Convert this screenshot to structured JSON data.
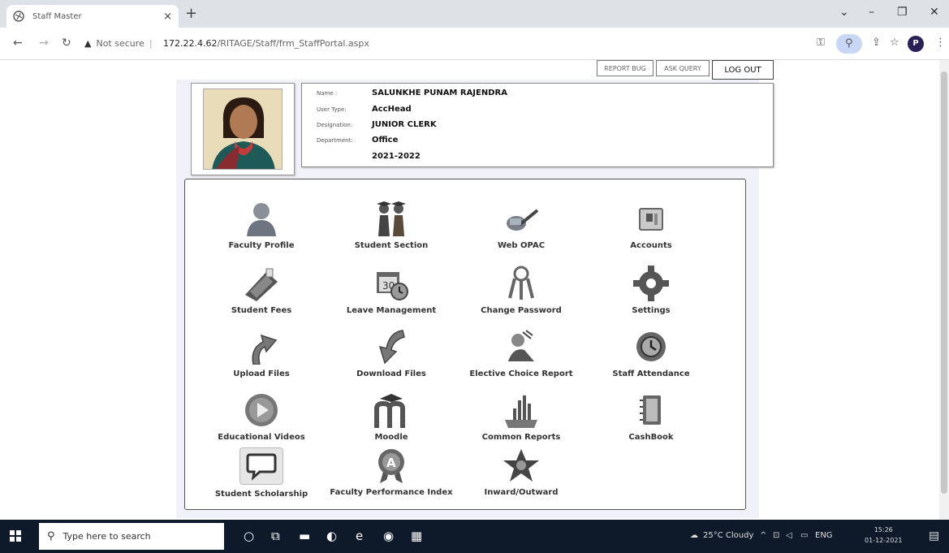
{
  "browser": {
    "tab_title": "Staff Master",
    "tab_close": "×",
    "new_tab": "+",
    "security_label": "Not secure",
    "url_host": "172.22.4.62",
    "url_path": "/RITAGE/Staff/frm_StaffPortal.aspx",
    "profile_initial": "P"
  },
  "header_buttons": {
    "report_bug": "REPORT BUG",
    "ask_query": "ASK QUERY",
    "logout": "LOG OUT"
  },
  "profile": {
    "name_label": "Name :",
    "name": "SALUNKHE PUNAM RAJENDRA",
    "user_type_label": "User Type:",
    "user_type": "AccHead",
    "designation_label": "Designation:",
    "designation": "JUNIOR CLERK",
    "department_label": "Department:",
    "department": "Office",
    "academic_year": "2021-2022"
  },
  "menu": [
    {
      "label": "Faculty Profile",
      "icon": "person-icon"
    },
    {
      "label": "Student Section",
      "icon": "students-icon"
    },
    {
      "label": "Web OPAC",
      "icon": "opac-icon"
    },
    {
      "label": "Accounts",
      "icon": "accounts-icon"
    },
    {
      "label": "Student Fees",
      "icon": "fees-machine-icon"
    },
    {
      "label": "Leave Management",
      "icon": "calendar-clock-icon"
    },
    {
      "label": "Change Password",
      "icon": "keys-icon"
    },
    {
      "label": "Settings",
      "icon": "gear-icon"
    },
    {
      "label": "Upload Files",
      "icon": "upload-arrow-icon"
    },
    {
      "label": "Download Files",
      "icon": "download-arrow-icon"
    },
    {
      "label": "Elective Choice Report",
      "icon": "elective-icon"
    },
    {
      "label": "Staff Attendance",
      "icon": "attendance-clock-icon"
    },
    {
      "label": "Educational Videos",
      "icon": "play-icon"
    },
    {
      "label": "Moodle",
      "icon": "moodle-icon"
    },
    {
      "label": "Common Reports",
      "icon": "reports-chart-icon"
    },
    {
      "label": "CashBook",
      "icon": "cashbook-icon"
    },
    {
      "label": "Student Scholarship",
      "icon": "speech-bubble-icon"
    },
    {
      "label": "Faculty Performance Index",
      "icon": "award-icon"
    },
    {
      "label": "Inward/Outward",
      "icon": "star-flower-icon"
    }
  ],
  "taskbar": {
    "search_placeholder": "Type here to search",
    "weather": "25°C Cloudy",
    "language": "ENG",
    "time": "15:26",
    "date": "01-12-2021"
  },
  "colors": {
    "panel_background": "#f1f2f9",
    "taskbar": "#0e1a2a",
    "tabstrip": "#dee1e6"
  }
}
